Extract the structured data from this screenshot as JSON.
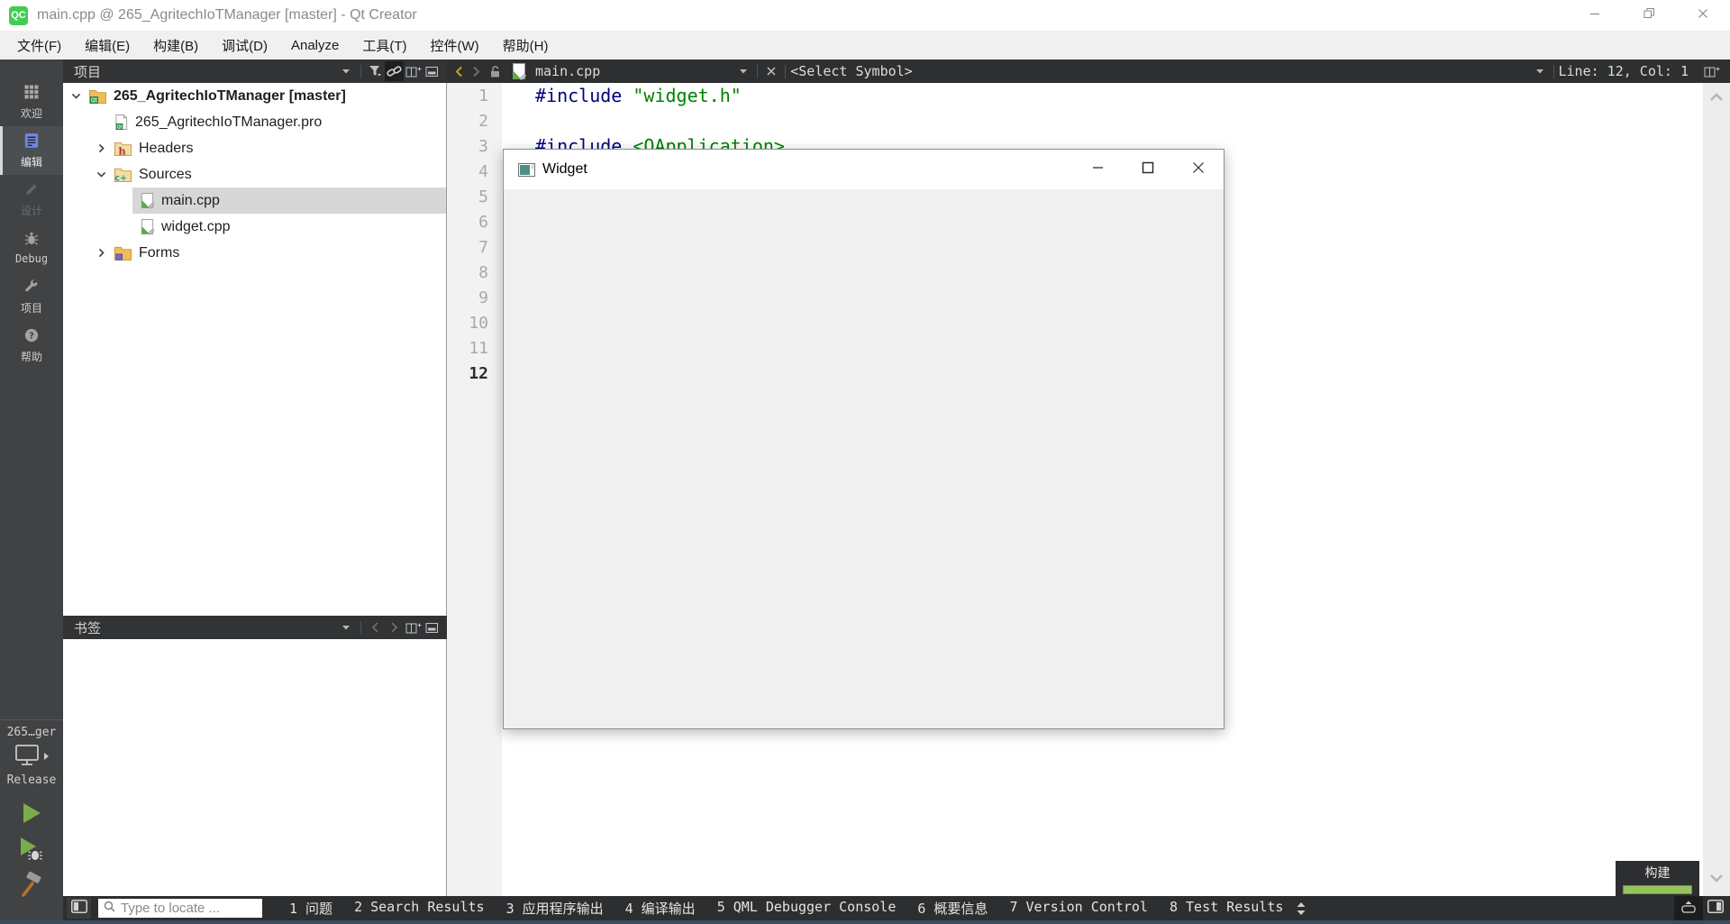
{
  "colors": {
    "preprocessor": "#000080",
    "string-green": "#008000",
    "run-green": "#79ad4a",
    "progress-green": "#95c45f",
    "hammer-orange": "#b5722d",
    "edit-mode-blue": "#7286e2"
  },
  "window": {
    "logo_text": "QC",
    "title": "main.cpp @ 265_AgritechIoTManager [master] - Qt Creator"
  },
  "menu": {
    "items": [
      "文件(F)",
      "编辑(E)",
      "构建(B)",
      "调试(D)",
      "Analyze",
      "工具(T)",
      "控件(W)",
      "帮助(H)"
    ]
  },
  "sidebar": {
    "modes": [
      {
        "label": "欢迎",
        "icon": "grid",
        "state": "normal"
      },
      {
        "label": "编辑",
        "icon": "edit",
        "state": "active"
      },
      {
        "label": "设计",
        "icon": "pencil",
        "state": "disabled"
      },
      {
        "label": "Debug",
        "icon": "bug",
        "state": "normal"
      },
      {
        "label": "项目",
        "icon": "wrench",
        "state": "normal"
      },
      {
        "label": "帮助",
        "icon": "help",
        "state": "normal"
      }
    ],
    "kit_selector": {
      "project": "265…ger",
      "build_config": "Release"
    }
  },
  "projects_pane": {
    "title": "项目",
    "tree": [
      {
        "level": 0,
        "chevron": "down",
        "icon": "folder-qt",
        "label": "265_AgritechIoTManager [master]",
        "bold": true,
        "selected": false
      },
      {
        "level": 1,
        "chevron": null,
        "icon": "file-pro",
        "label": "265_AgritechIoTManager.pro",
        "bold": false,
        "selected": false
      },
      {
        "level": 1,
        "chevron": "right",
        "icon": "folder-h",
        "label": "Headers",
        "bold": false,
        "selected": false
      },
      {
        "level": 1,
        "chevron": "down",
        "icon": "folder-cpp",
        "label": "Sources",
        "bold": false,
        "selected": false
      },
      {
        "level": 2,
        "chevron": null,
        "icon": "file-cpp",
        "label": "main.cpp",
        "bold": false,
        "selected": true
      },
      {
        "level": 2,
        "chevron": null,
        "icon": "file-cpp",
        "label": "widget.cpp",
        "bold": false,
        "selected": false
      },
      {
        "level": 1,
        "chevron": "right",
        "icon": "folder-forms",
        "label": "Forms",
        "bold": false,
        "selected": false
      }
    ]
  },
  "bookmarks_pane": {
    "title": "书签"
  },
  "editor": {
    "open_file": "main.cpp",
    "symbol_selector": "<Select Symbol>",
    "cursor_position": "Line: 12, Col: 1",
    "current_line": 12,
    "lines": [
      {
        "number": 1,
        "segments": [
          {
            "text": "#include ",
            "type": "preprocessor"
          },
          {
            "text": "\"widget.h\"",
            "type": "string"
          }
        ]
      },
      {
        "number": 2,
        "segments": []
      },
      {
        "number": 3,
        "segments": [
          {
            "text": "#include ",
            "type": "preprocessor"
          },
          {
            "text": "<QApplication>",
            "type": "string"
          }
        ]
      },
      {
        "number": 4,
        "segments": []
      },
      {
        "number": 5,
        "segments": []
      },
      {
        "number": 6,
        "segments": []
      },
      {
        "number": 7,
        "segments": []
      },
      {
        "number": 8,
        "segments": []
      },
      {
        "number": 9,
        "segments": []
      },
      {
        "number": 10,
        "segments": []
      },
      {
        "number": 11,
        "segments": []
      },
      {
        "number": 12,
        "segments": []
      }
    ]
  },
  "app_window": {
    "title": "Widget"
  },
  "build_popup": {
    "label": "构建",
    "progress_percent": 100
  },
  "status_bar": {
    "locator_placeholder": "Type to locate ...",
    "panes": [
      "1 问题",
      "2 Search Results",
      "3 应用程序输出",
      "4 编译输出",
      "5 QML Debugger Console",
      "6 概要信息",
      "7 Version Control",
      "8 Test Results"
    ]
  }
}
